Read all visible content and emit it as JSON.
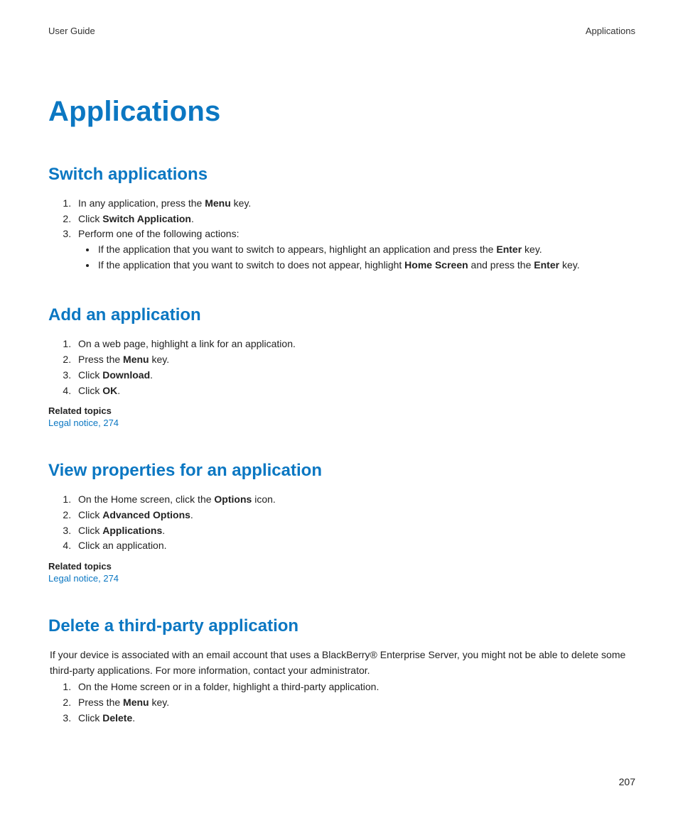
{
  "header": {
    "left": "User Guide",
    "right": "Applications"
  },
  "title": "Applications",
  "sections": [
    {
      "heading": "Switch applications",
      "type": "list_with_sublist",
      "items": [
        {
          "runs": [
            {
              "t": "In any application, press the "
            },
            {
              "t": "Menu",
              "bold": true
            },
            {
              "t": " key."
            }
          ]
        },
        {
          "runs": [
            {
              "t": "Click "
            },
            {
              "t": "Switch Application",
              "bold": true
            },
            {
              "t": "."
            }
          ]
        },
        {
          "runs": [
            {
              "t": "Perform one of the following actions:"
            }
          ],
          "subitems": [
            {
              "runs": [
                {
                  "t": "If the application that you want to switch to appears, highlight an application and press the "
                },
                {
                  "t": "Enter",
                  "bold": true
                },
                {
                  "t": " key."
                }
              ]
            },
            {
              "runs": [
                {
                  "t": "If the application that you want to switch to does not appear, highlight "
                },
                {
                  "t": "Home Screen",
                  "bold": true
                },
                {
                  "t": " and press the "
                },
                {
                  "t": "Enter",
                  "bold": true
                },
                {
                  "t": " key."
                }
              ]
            }
          ]
        }
      ]
    },
    {
      "heading": "Add an application",
      "type": "list",
      "items": [
        {
          "runs": [
            {
              "t": "On a web page, highlight a link for an application."
            }
          ]
        },
        {
          "runs": [
            {
              "t": "Press the "
            },
            {
              "t": "Menu",
              "bold": true
            },
            {
              "t": " key."
            }
          ]
        },
        {
          "runs": [
            {
              "t": "Click "
            },
            {
              "t": "Download",
              "bold": true
            },
            {
              "t": "."
            }
          ]
        },
        {
          "runs": [
            {
              "t": "Click "
            },
            {
              "t": "OK",
              "bold": true
            },
            {
              "t": "."
            }
          ]
        }
      ],
      "related_heading": "Related topics",
      "related_link": "Legal notice, 274"
    },
    {
      "heading": "View properties for an application",
      "type": "list",
      "items": [
        {
          "runs": [
            {
              "t": "On the Home screen, click the "
            },
            {
              "t": "Options",
              "bold": true
            },
            {
              "t": " icon."
            }
          ]
        },
        {
          "runs": [
            {
              "t": "Click "
            },
            {
              "t": "Advanced Options",
              "bold": true
            },
            {
              "t": "."
            }
          ]
        },
        {
          "runs": [
            {
              "t": "Click "
            },
            {
              "t": "Applications",
              "bold": true
            },
            {
              "t": "."
            }
          ]
        },
        {
          "runs": [
            {
              "t": "Click an application."
            }
          ]
        }
      ],
      "related_heading": "Related topics",
      "related_link": "Legal notice, 274"
    },
    {
      "heading": "Delete a third-party application",
      "type": "intro_list",
      "intro_runs": [
        {
          "t": "If your device is associated with an email account that uses a BlackBerry® Enterprise Server, you might not be able to delete some third-party applications. For more information, contact your administrator."
        }
      ],
      "items": [
        {
          "runs": [
            {
              "t": "On the Home screen or in a folder, highlight a third-party application."
            }
          ]
        },
        {
          "runs": [
            {
              "t": "Press the "
            },
            {
              "t": "Menu",
              "bold": true
            },
            {
              "t": " key."
            }
          ]
        },
        {
          "runs": [
            {
              "t": "Click "
            },
            {
              "t": "Delete",
              "bold": true
            },
            {
              "t": "."
            }
          ]
        }
      ]
    }
  ],
  "page_number": "207"
}
